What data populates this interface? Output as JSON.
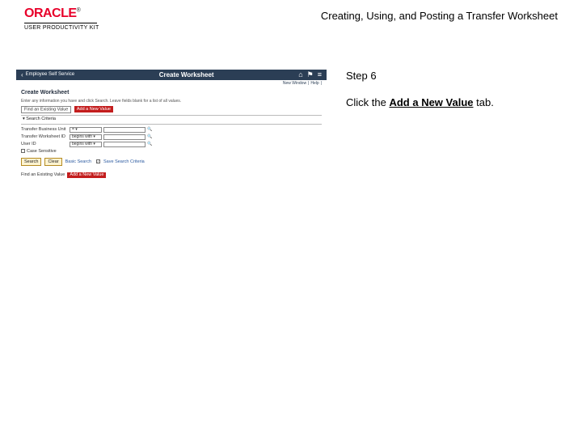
{
  "header": {
    "brand": "ORACLE",
    "brand_tm": "®",
    "product": "USER PRODUCTIVITY KIT",
    "doc_title": "Creating, Using, and Posting a Transfer Worksheet"
  },
  "instructions": {
    "step_label": "Step 6",
    "text_prefix": "Click the ",
    "link_text": "Add a New Value",
    "text_suffix": " tab."
  },
  "mini": {
    "back_label": "Employee Self Service",
    "header_title": "Create Worksheet",
    "sub_nav": {
      "new_window": "New Window",
      "help": "Help"
    },
    "page_title": "Create Worksheet",
    "desc": "Enter any information you have and click Search. Leave fields blank for a list of all values.",
    "tabs": {
      "existing": "Find an Existing Value",
      "new_value": "Add a New Value"
    },
    "search_criteria_header": "▾ Search Criteria",
    "fields": {
      "row1": {
        "label": "Transfer Business Unit",
        "op": "= ▾"
      },
      "row2": {
        "label": "Transfer Worksheet ID",
        "op": "begins with ▾"
      },
      "row3": {
        "label": "User ID",
        "op": "begins with ▾"
      }
    },
    "case_sensitive": "Case Sensitive",
    "buttons": {
      "search": "Search",
      "clear": "Clear",
      "basic": "Basic Search",
      "save_check": "✓",
      "save_label": "Save Search Criteria"
    },
    "find_existing": {
      "label": "Find an Existing Value",
      "chip": "Add a New Value"
    }
  }
}
